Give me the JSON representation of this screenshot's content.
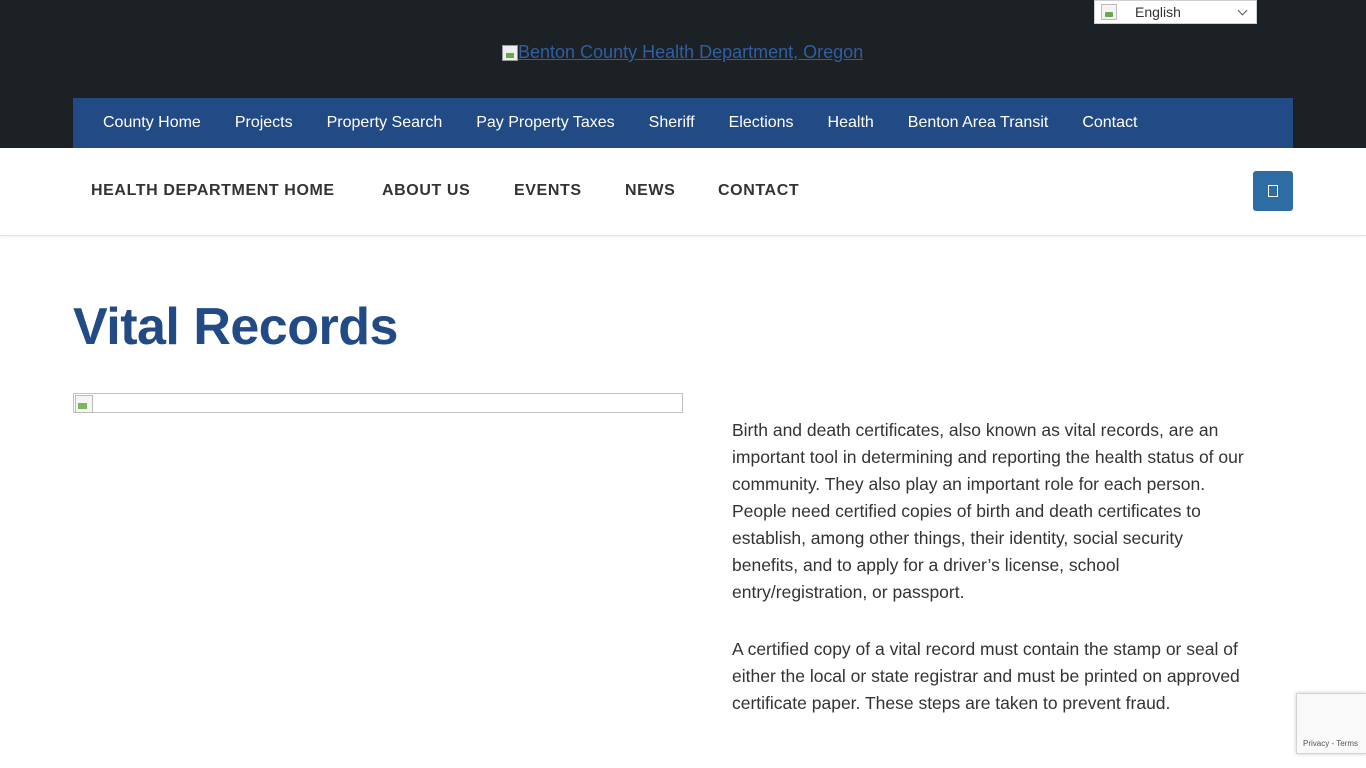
{
  "header": {
    "language": {
      "selected": "English",
      "flag_icon": "english-flag-icon"
    },
    "logo_alt": "Benton County Health Department, Oregon",
    "county_nav": [
      "County Home",
      "Projects",
      "Property Search",
      "Pay Property Taxes",
      "Sheriff",
      "Elections",
      "Health",
      "Benton Area Transit",
      "Contact"
    ]
  },
  "dept_nav": {
    "items": [
      "HEALTH DEPARTMENT HOME",
      "ABOUT US",
      "EVENTS",
      "NEWS",
      "CONTACT"
    ],
    "menu_icon": "menu-icon"
  },
  "main": {
    "title": "Vital Records",
    "paragraphs": [
      "Birth and death certificates, also known as vital records, are an important tool in determining and reporting the health status of our community. They also play an important role for each person. People need certified copies of birth and death certificates to establish, among other things, their identity, social security benefits, and to apply for a driver’s license, school entry/registration, or passport.",
      "A certified copy of a vital record must contain the stamp or seal of either the local or state registrar and must be printed on approved certificate paper. These steps are taken to prevent fraud."
    ]
  },
  "recaptcha": {
    "privacy": "Privacy",
    "separator": " - ",
    "terms": "Terms"
  },
  "colors": {
    "topbar": "#1c2126",
    "county_nav": "#224a84",
    "title": "#224a84",
    "menu_button": "#2e6da4"
  }
}
